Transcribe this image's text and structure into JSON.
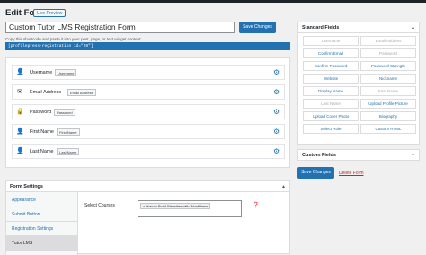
{
  "header": {
    "title": "Edit Form",
    "live_preview": "Live Preview"
  },
  "form": {
    "title_value": "Custom Tutor LMS Registration Form",
    "save_label": "Save Changes",
    "shortcode_hint": "Copy this shortcode and paste it into your post, page, or text widget content:",
    "shortcode": "[profilepress-registration id=\"29\"]"
  },
  "fields": [
    {
      "icon": "user-icon",
      "label": "Username",
      "tag": "Username"
    },
    {
      "icon": "envelope-icon",
      "label": "Email Address",
      "tag": "Email Address"
    },
    {
      "icon": "lock-icon",
      "label": "Password",
      "tag": "Password"
    },
    {
      "icon": "user-icon",
      "label": "First Name",
      "tag": "First Name"
    },
    {
      "icon": "user-icon",
      "label": "Last Name",
      "tag": "Last Name"
    }
  ],
  "form_settings": {
    "title": "Form Settings",
    "tabs": [
      "Appearance",
      "Submit Button",
      "Registration Settings",
      "Tutor LMS"
    ],
    "active_tab": "Tutor LMS",
    "select_label": "Select Courses",
    "selected_course": "× How to Build Websites with WordPress"
  },
  "standard_fields": {
    "title": "Standard Fields",
    "buttons": [
      {
        "label": "Username",
        "enabled": false
      },
      {
        "label": "Email Address",
        "enabled": false
      },
      {
        "label": "Confirm Email",
        "enabled": true
      },
      {
        "label": "Password",
        "enabled": false
      },
      {
        "label": "Confirm Password",
        "enabled": true
      },
      {
        "label": "Password Strength",
        "enabled": true
      },
      {
        "label": "Website",
        "enabled": true
      },
      {
        "label": "Nickname",
        "enabled": true
      },
      {
        "label": "Display Name",
        "enabled": true
      },
      {
        "label": "First Name",
        "enabled": false
      },
      {
        "label": "Last Name",
        "enabled": false
      },
      {
        "label": "Upload Profile Picture",
        "enabled": true
      },
      {
        "label": "Upload Cover Photo",
        "enabled": true
      },
      {
        "label": "Biography",
        "enabled": true
      },
      {
        "label": "Select Role",
        "enabled": true
      },
      {
        "label": "Custom HTML",
        "enabled": true
      }
    ]
  },
  "custom_fields": {
    "title": "Custom Fields"
  },
  "sidebar_actions": {
    "save_label": "Save Changes",
    "delete_label": "Delete Form"
  },
  "colors": {
    "accent": "#2271b1",
    "danger": "#b32d2e",
    "background": "#f0f0f1"
  }
}
